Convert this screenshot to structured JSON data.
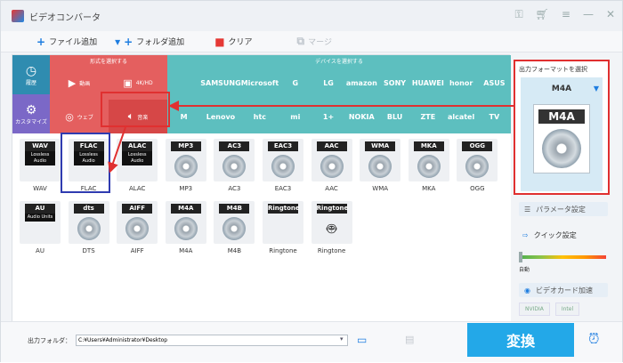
{
  "app": {
    "title": "ビデオコンバータ"
  },
  "toolbar": {
    "add_file": "ファイル追加",
    "add_folder": "フォルダ追加",
    "clear": "クリア",
    "merge": "マージ"
  },
  "categories": {
    "format_head": "形式を選択する",
    "device_head": "デバイスを選択する",
    "history": "履歴",
    "custom": "カスタマイズ",
    "video": "動画",
    "k4": "4K/HD",
    "web": "ウェブ",
    "music": "音楽",
    "devices_row1": [
      "",
      "SAMSUNG",
      "Microsoft",
      "G",
      "LG",
      "amazon",
      "SONY",
      "HUAWEI",
      "honor",
      "ASUS"
    ],
    "devices_row2": [
      "M",
      "Lenovo",
      "htc",
      "mi",
      "1+",
      "NOKIA",
      "BLU",
      "ZTE",
      "alcatel",
      "TV"
    ]
  },
  "formats": [
    {
      "tag": "WAV",
      "sub": "Lossless Audio",
      "label": "WAV"
    },
    {
      "tag": "FLAC",
      "sub": "Lossless Audio",
      "label": "FLAC"
    },
    {
      "tag": "ALAC",
      "sub": "Lossless Audio",
      "label": "ALAC"
    },
    {
      "tag": "MP3",
      "sub": "",
      "label": "MP3"
    },
    {
      "tag": "AC3",
      "sub": "",
      "label": "AC3"
    },
    {
      "tag": "EAC3",
      "sub": "",
      "label": "EAC3"
    },
    {
      "tag": "AAC",
      "sub": "",
      "label": "AAC"
    },
    {
      "tag": "WMA",
      "sub": "",
      "label": "WMA"
    },
    {
      "tag": "MKA",
      "sub": "",
      "label": "MKA"
    },
    {
      "tag": "OGG",
      "sub": "",
      "label": "OGG"
    },
    {
      "tag": "AU",
      "sub": "Audio Units",
      "label": "AU"
    },
    {
      "tag": "dts",
      "sub": "",
      "label": "DTS"
    },
    {
      "tag": "AIFF",
      "sub": "",
      "label": "AIFF"
    },
    {
      "tag": "M4A",
      "sub": "",
      "label": "M4A"
    },
    {
      "tag": "M4B",
      "sub": "",
      "label": "M4B"
    },
    {
      "tag": "Ringtone",
      "sub": "",
      "label": "Ringtone"
    },
    {
      "tag": "Ringtone",
      "sub": "",
      "label": "Ringtone"
    }
  ],
  "output": {
    "title": "出力フォーマットを選択",
    "format": "M4A",
    "icon_tag": "M4A"
  },
  "settings": {
    "params": "パラメータ設定",
    "quick": "クイック設定",
    "auto": "自動",
    "gpu": "ビデオカード加速",
    "nvidia": "NVIDIA",
    "intel": "Intel"
  },
  "bottom": {
    "folder_label": "出力フォルダ：",
    "path": "C:¥Users¥Administrator¥Desktop",
    "convert": "変換"
  },
  "colors": {
    "accent": "#23a8e8",
    "highlight": "#e03030",
    "music_bg": "#e45f5f",
    "device_bg": "#5dbfbf"
  }
}
